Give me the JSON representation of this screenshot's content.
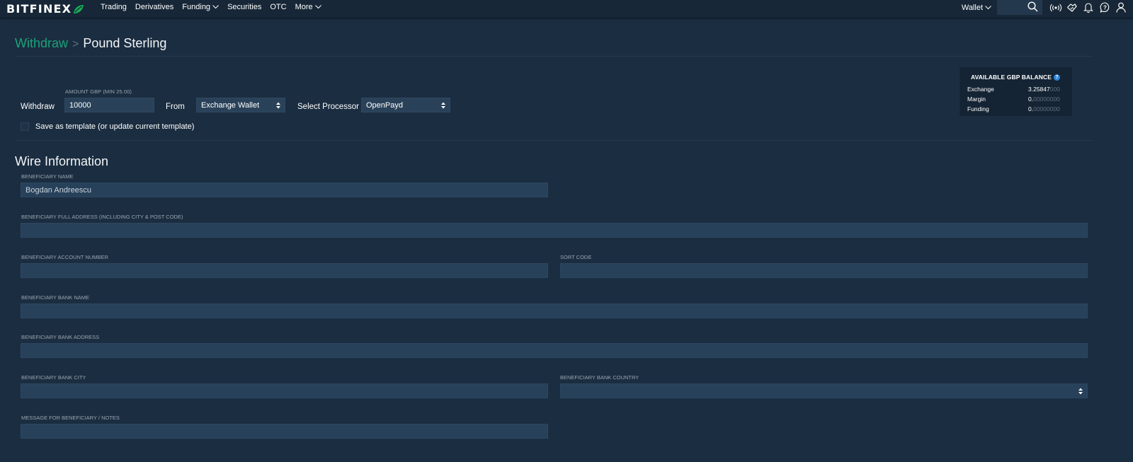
{
  "topnav": {
    "logo": "BITFINEX",
    "items": [
      {
        "label": "Trading",
        "has_dropdown": false
      },
      {
        "label": "Derivatives",
        "has_dropdown": false
      },
      {
        "label": "Funding",
        "has_dropdown": true
      },
      {
        "label": "Securities",
        "has_dropdown": false
      },
      {
        "label": "OTC",
        "has_dropdown": false
      },
      {
        "label": "More",
        "has_dropdown": true
      }
    ],
    "wallet_label": "Wallet",
    "search_placeholder": "",
    "icons": [
      "search-icon",
      "broadcast-icon",
      "handshake-icon",
      "bell-icon",
      "help-icon",
      "user-icon"
    ]
  },
  "breadcrumb": {
    "parent": "Withdraw",
    "separator": ">",
    "current": "Pound Sterling"
  },
  "withdraw_form": {
    "withdraw_label": "Withdraw",
    "amount_label": "AMOUNT GBP (MIN 25.00)",
    "amount_value": "10000",
    "from_label": "From",
    "from_value": "Exchange Wallet",
    "processor_label": "Select Processor",
    "processor_value": "OpenPayd",
    "template_checkbox_label": "Save as template (or update current template)",
    "template_checked": false
  },
  "balance": {
    "title": "AVAILABLE GBP BALANCE",
    "help_glyph": "?",
    "rows": [
      {
        "label": "Exchange",
        "value_main": "3.25847",
        "value_faded": "000"
      },
      {
        "label": "Margin",
        "value_main": "0.",
        "value_faded": "00000000"
      },
      {
        "label": "Funding",
        "value_main": "0.",
        "value_faded": "00000000"
      }
    ]
  },
  "wire": {
    "title": "Wire Information",
    "fields": {
      "beneficiary_name": {
        "label": "BENEFICIARY NAME",
        "value": "Bogdan Andreescu"
      },
      "beneficiary_address": {
        "label": "BENEFICIARY FULL ADDRESS (INCLUDING CITY & POST CODE)",
        "value": ""
      },
      "account_number": {
        "label": "BENEFICIARY ACCOUNT NUMBER",
        "value": ""
      },
      "sort_code": {
        "label": "SORT CODE",
        "value": ""
      },
      "bank_name": {
        "label": "BENEFICIARY BANK NAME",
        "value": ""
      },
      "bank_address": {
        "label": "BENEFICIARY BANK ADDRESS",
        "value": ""
      },
      "bank_city": {
        "label": "BENEFICIARY BANK CITY",
        "value": ""
      },
      "bank_country": {
        "label": "BENEFICIARY BANK COUNTRY",
        "value": ""
      },
      "message": {
        "label": "MESSAGE FOR BENEFICIARY / NOTES",
        "value": ""
      }
    }
  },
  "colors": {
    "background": "#1b2d40",
    "nav_background": "#172737",
    "input_background": "#27415a",
    "accent_green": "#1aa37a",
    "help_blue": "#2f86d8"
  }
}
